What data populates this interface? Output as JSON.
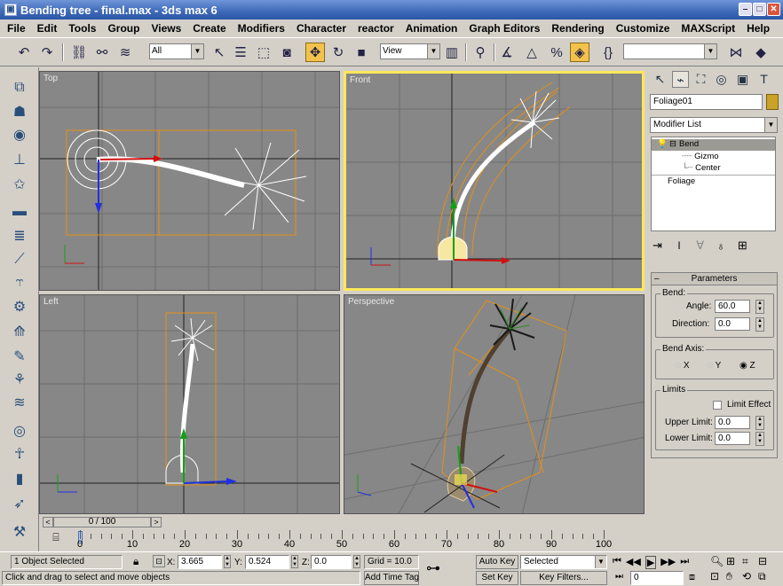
{
  "window": {
    "title": "Bending tree - final.max - 3ds max 6",
    "app_icon": "3ds-max-icon"
  },
  "menu": [
    "File",
    "Edit",
    "Tools",
    "Group",
    "Views",
    "Create",
    "Modifiers",
    "Character",
    "reactor",
    "Animation",
    "Graph Editors",
    "Rendering",
    "Customize",
    "MAXScript",
    "Help"
  ],
  "toolbar": {
    "selection_filter": "All",
    "ref_coord": "View",
    "named_selection": ""
  },
  "viewports": {
    "top": "Top",
    "front": "Front",
    "left": "Left",
    "perspective": "Perspective"
  },
  "command_panel": {
    "object_name": "Foliage01",
    "object_color": "#c9a227",
    "modifier_list": "Modifier List",
    "stack": [
      "Bend",
      "Gizmo",
      "Center",
      "Foliage"
    ],
    "parameters": {
      "title": "Parameters",
      "bend_group": "Bend:",
      "angle_label": "Angle:",
      "angle": "60.0",
      "direction_label": "Direction:",
      "direction": "0.0",
      "axis_group": "Bend Axis:",
      "axis_x": "X",
      "axis_y": "Y",
      "axis_z": "Z",
      "selected_axis": "Z",
      "limits_group": "Limits",
      "limit_effect": "Limit Effect",
      "upper_label": "Upper Limit:",
      "upper": "0.0",
      "lower_label": "Lower Limit:",
      "lower": "0.0"
    }
  },
  "timeline": {
    "frame_display": "0 / 100",
    "ticks": [
      "0",
      "10",
      "20",
      "30",
      "40",
      "50",
      "60",
      "70",
      "80",
      "90",
      "100"
    ]
  },
  "status": {
    "selection": "1 Object Selected",
    "prompt": "Click and drag to select and move objects",
    "x_label": "X:",
    "x": "3.665",
    "y_label": "Y:",
    "y": "0.524",
    "z_label": "Z:",
    "z": "0.0",
    "grid": "Grid = 10.0",
    "add_time_tag": "Add Time Tag",
    "auto_key": "Auto Key",
    "set_key": "Set Key",
    "selected": "Selected",
    "key_filters": "Key Filters...",
    "frame": "0"
  }
}
